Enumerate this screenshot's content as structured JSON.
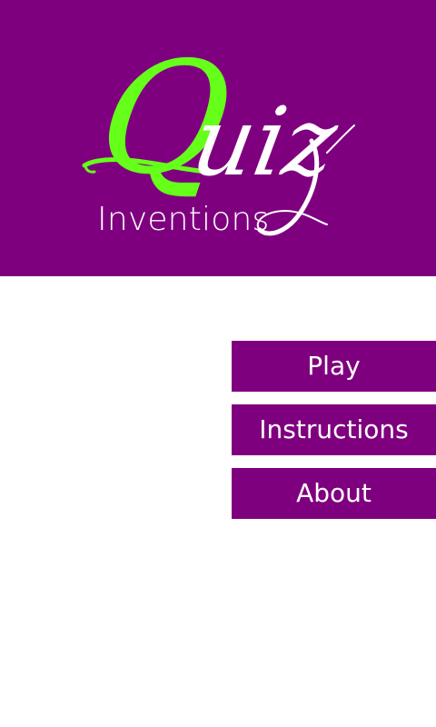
{
  "header": {
    "logo_initial": "Q",
    "logo_rest": "uiz",
    "subtitle": "Inventions"
  },
  "menu": {
    "play_label": "Play",
    "instructions_label": "Instructions",
    "about_label": "About"
  },
  "colors": {
    "primary": "#7f007f",
    "logo_accent": "#66ff1a",
    "text_on_primary": "#ffffff",
    "background": "#ffffff"
  }
}
